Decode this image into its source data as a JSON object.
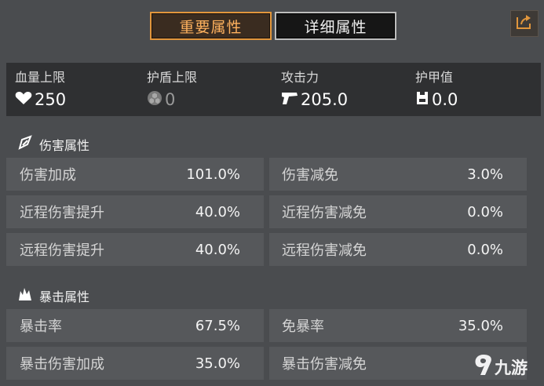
{
  "tabs": [
    {
      "label": "重要属性",
      "active": true
    },
    {
      "label": "详细属性",
      "active": false
    }
  ],
  "summary": [
    {
      "label": "血量上限",
      "value": "250",
      "icon": "heart-icon"
    },
    {
      "label": "护盾上限",
      "value": "0",
      "icon": "shield-hex-icon"
    },
    {
      "label": "攻击力",
      "value": "205.0",
      "icon": "gun-icon"
    },
    {
      "label": "护甲值",
      "value": "0.0",
      "icon": "armor-icon"
    }
  ],
  "sections": [
    {
      "title": "伤害属性",
      "icon": "damage-icon",
      "rows": [
        [
          {
            "label": "伤害加成",
            "value": "101.0%"
          },
          {
            "label": "伤害减免",
            "value": "3.0%"
          }
        ],
        [
          {
            "label": "近程伤害提升",
            "value": "40.0%"
          },
          {
            "label": "近程伤害减免",
            "value": "0.0%"
          }
        ],
        [
          {
            "label": "远程伤害提升",
            "value": "40.0%"
          },
          {
            "label": "远程伤害减免",
            "value": "0.0%"
          }
        ]
      ]
    },
    {
      "title": "暴击属性",
      "icon": "crit-icon",
      "rows": [
        [
          {
            "label": "暴击率",
            "value": "67.5%"
          },
          {
            "label": "免暴率",
            "value": "35.0%"
          }
        ],
        [
          {
            "label": "暴击伤害加成",
            "value": "35.0%"
          },
          {
            "label": "暴击伤害减免",
            "value": ""
          }
        ]
      ]
    }
  ],
  "watermark": "九游"
}
